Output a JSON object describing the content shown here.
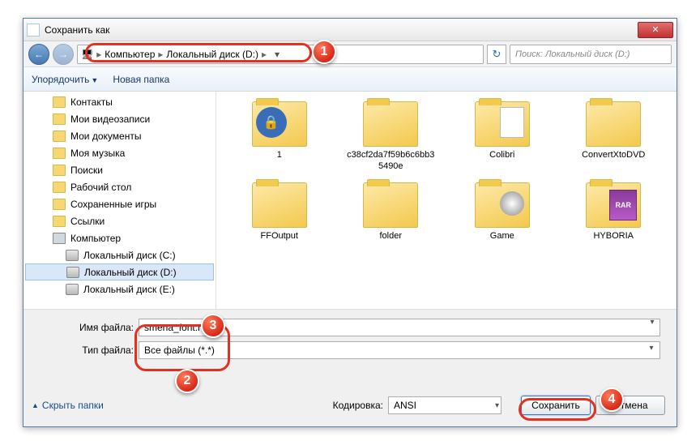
{
  "title": "Сохранить как",
  "nav": {
    "computer": "Компьютер",
    "drive": "Локальный диск (D:)",
    "search_placeholder": "Поиск: Локальный диск (D:)"
  },
  "toolbar": {
    "organize": "Упорядочить",
    "new_folder": "Новая папка"
  },
  "tree": {
    "items": [
      {
        "label": "Контакты",
        "type": "folder",
        "indent": 0
      },
      {
        "label": "Мои видеозаписи",
        "type": "folder",
        "indent": 0
      },
      {
        "label": "Мои документы",
        "type": "folder",
        "indent": 0
      },
      {
        "label": "Моя музыка",
        "type": "folder",
        "indent": 0
      },
      {
        "label": "Поиски",
        "type": "folder",
        "indent": 0
      },
      {
        "label": "Рабочий стол",
        "type": "folder",
        "indent": 0
      },
      {
        "label": "Сохраненные игры",
        "type": "folder",
        "indent": 0
      },
      {
        "label": "Ссылки",
        "type": "folder",
        "indent": 0
      },
      {
        "label": "Компьютер",
        "type": "comp",
        "indent": 0
      },
      {
        "label": "Локальный диск (C:)",
        "type": "drive",
        "indent": 1
      },
      {
        "label": "Локальный диск (D:)",
        "type": "drive",
        "indent": 1,
        "selected": true
      },
      {
        "label": "Локальный диск (E:)",
        "type": "drive",
        "indent": 1
      }
    ]
  },
  "files": [
    {
      "label": "1",
      "variant": "music lock"
    },
    {
      "label": "c38cf2da7f59b6c6bb35490e",
      "variant": ""
    },
    {
      "label": "Colibri",
      "variant": "doc"
    },
    {
      "label": "ConvertXtoDVD",
      "variant": ""
    },
    {
      "label": "FFOutput",
      "variant": ""
    },
    {
      "label": "folder",
      "variant": ""
    },
    {
      "label": "Game",
      "variant": "game"
    },
    {
      "label": "HYBORIA",
      "variant": "rar"
    }
  ],
  "fields": {
    "filename_label": "Имя файла:",
    "filename_value": "smena_font.reg",
    "filetype_label": "Тип файла:",
    "filetype_value": "Все файлы  (*.*)"
  },
  "footer": {
    "hide_folders": "Скрыть папки",
    "encoding_label": "Кодировка:",
    "encoding_value": "ANSI",
    "save": "Сохранить",
    "cancel": "Отмена"
  },
  "markers": {
    "m1": "1",
    "m2": "2",
    "m3": "3",
    "m4": "4"
  }
}
